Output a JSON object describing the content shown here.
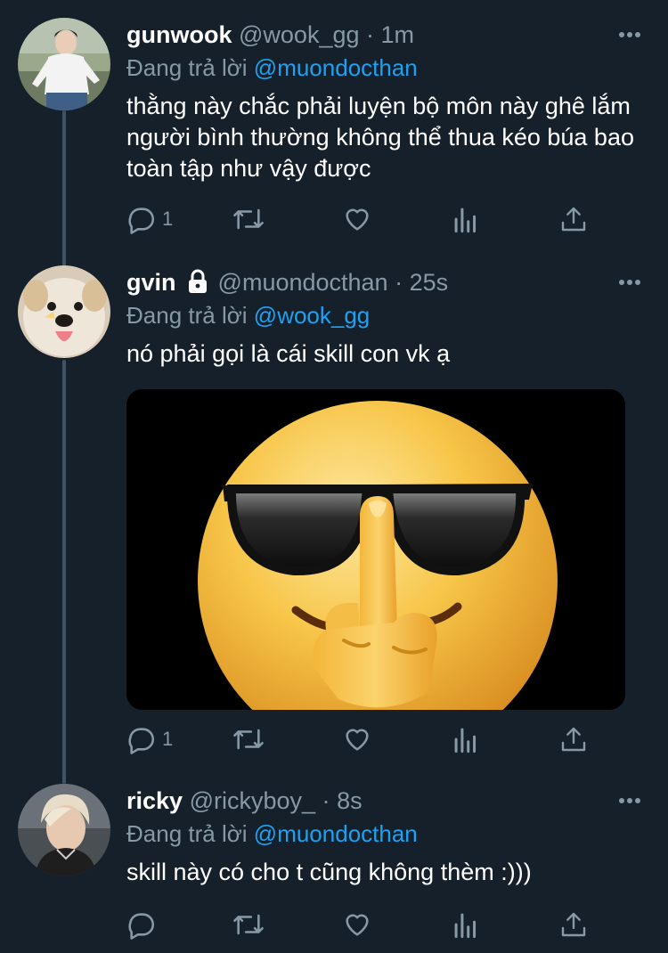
{
  "tweets": [
    {
      "display_name": "gunwook",
      "handle": "@wook_gg",
      "separator": "·",
      "time": "1m",
      "reply_prefix": "Đang trả lời",
      "reply_mention": "@muondocthan",
      "text": "thằng này chắc phải luyện bộ môn này ghê lắm người bình thường không thể thua kéo búa bao toàn tập như vậy được",
      "reply_count": "1",
      "locked": false
    },
    {
      "display_name": "gvin",
      "handle": "@muondocthan",
      "separator": "·",
      "time": "25s",
      "reply_prefix": "Đang trả lời",
      "reply_mention": "@wook_gg",
      "text": "nó phải gọi là cái skill con vk ạ",
      "reply_count": "1",
      "locked": true,
      "media": "sunglasses-emoji-middle-finger"
    },
    {
      "display_name": "ricky",
      "handle": "@rickyboy_",
      "separator": "·",
      "time": "8s",
      "reply_prefix": "Đang trả lời",
      "reply_mention": "@muondocthan",
      "text": "skill này có cho t cũng không thèm :)))",
      "reply_count": "",
      "locked": false
    }
  ],
  "colors": {
    "background": "#15202b",
    "text": "#ffffff",
    "secondary": "#8899a6",
    "link": "#1da1f2",
    "thread_line": "#3d5466"
  },
  "icons": [
    "reply-icon",
    "retweet-icon",
    "like-icon",
    "analytics-icon",
    "share-icon",
    "more-icon",
    "lock-icon"
  ]
}
